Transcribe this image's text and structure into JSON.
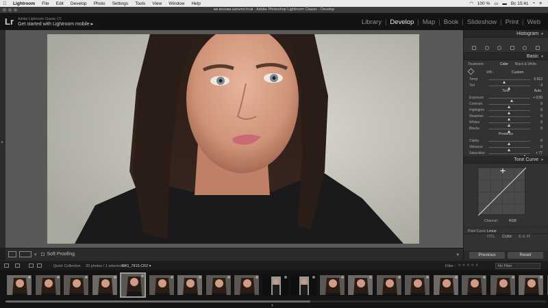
{
  "menubar": {
    "apple_icon": "apple-icon",
    "items": [
      "Lightroom",
      "File",
      "Edit",
      "Develop",
      "Photo",
      "Settings",
      "Tools",
      "View",
      "Window",
      "Help"
    ],
    "status": [
      "100 %",
      "Вс 15:41"
    ]
  },
  "window": {
    "title": "мк москва каталог.lrcat - Adobe Photoshop Lightroom Classic - Develop"
  },
  "identity": {
    "logo": "Lr",
    "line1": "Adobe Lightroom Classic CC",
    "line2": "Get started with Lightroom mobile ▸"
  },
  "modules": [
    "Library",
    "Develop",
    "Map",
    "Book",
    "Slideshow",
    "Print",
    "Web"
  ],
  "active_module": "Develop",
  "toolbar": {
    "soft_proofing": "Soft Proofing"
  },
  "panels": {
    "histogram": "Histogram",
    "basic": "Basic",
    "treatment_label": "Treatment :",
    "treatment_color": "Color",
    "treatment_bw": "Black & White",
    "wb_label": "WB :",
    "wb_value": "Custom",
    "tone_label": "Tone",
    "auto_label": "Auto",
    "presence_label": "Presence",
    "sliders_wb": [
      {
        "name": "Temp",
        "value": "5 012",
        "pos": 0.38
      },
      {
        "name": "Tint",
        "value": "- 3",
        "pos": 0.5
      }
    ],
    "sliders_tone": [
      {
        "name": "Exposure",
        "value": "+ 0,50",
        "pos": 0.56
      },
      {
        "name": "Contrast",
        "value": "0",
        "pos": 0.5
      },
      {
        "name": "Highlights",
        "value": "0",
        "pos": 0.5
      },
      {
        "name": "Shadows",
        "value": "0",
        "pos": 0.5
      },
      {
        "name": "Whites",
        "value": "0",
        "pos": 0.5
      },
      {
        "name": "Blacks",
        "value": "0",
        "pos": 0.5
      }
    ],
    "sliders_presence": [
      {
        "name": "Clarity",
        "value": "0",
        "pos": 0.5
      },
      {
        "name": "Vibrance",
        "value": "0",
        "pos": 0.5
      },
      {
        "name": "Saturation",
        "value": "+ 77",
        "pos": 0.88
      }
    ],
    "tone_curve": "Tone Curve",
    "channel_label": "Channel :",
    "channel_value": "RGB",
    "point_curve_label": "Point Curve :",
    "point_curve_value": "Linear",
    "hsl": "HSL",
    "color": "Color",
    "bw": "B & W",
    "previous": "Previous",
    "reset": "Reset"
  },
  "filmstrip_bar": {
    "source": "Quick Collection",
    "count": "33 photos / 1 selected /",
    "filename": "IMG_7815.CR2 ▾",
    "filter_label": "Filter :",
    "filter_value": "No Filter"
  },
  "filmstrip": {
    "count": 20,
    "selected_index": 4
  }
}
